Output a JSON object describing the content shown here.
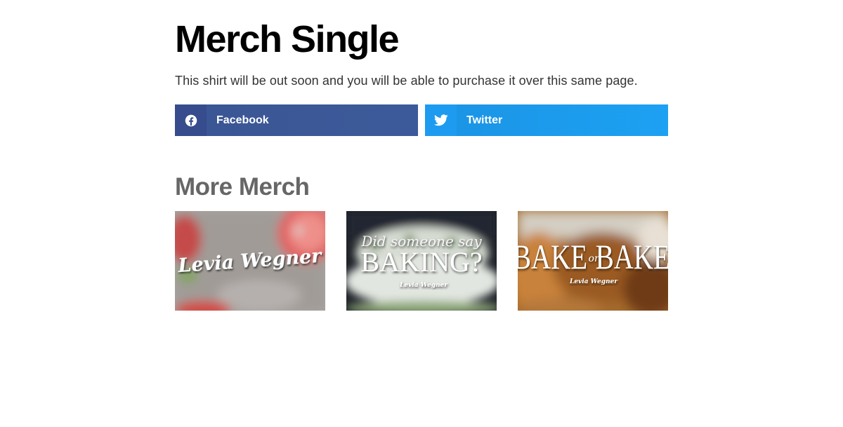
{
  "page": {
    "title": "Merch Single",
    "description": "This shirt will be out soon and you will be able to purchase it over this same page."
  },
  "share": {
    "facebook": {
      "label": "Facebook",
      "icon": "facebook-icon",
      "color": "#3b5998"
    },
    "twitter": {
      "label": "Twitter",
      "icon": "twitter-icon",
      "color": "#1da1f2"
    }
  },
  "more": {
    "heading": "More Merch",
    "items": [
      {
        "name": "Levia Wegner",
        "line1": "Levia Wegner"
      },
      {
        "name": "Did someone say BAKING?",
        "line1": "Did someone say",
        "line2": "BAKING?",
        "signature": "Levia Wegner"
      },
      {
        "name": "BAKE or BAKE",
        "word_left": "BAKE",
        "word_mid": "or",
        "word_right": "BAKE",
        "signature": "Levia Wegner"
      }
    ]
  }
}
